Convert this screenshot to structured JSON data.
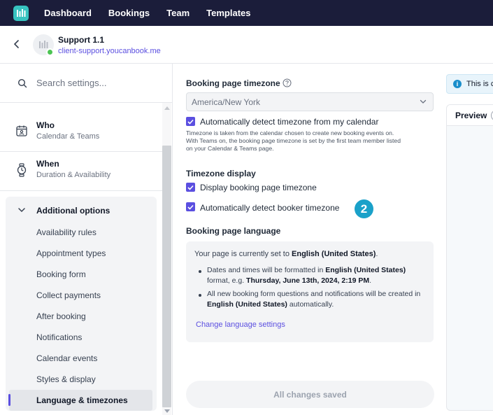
{
  "topnav": {
    "links": [
      "Dashboard",
      "Bookings",
      "Team",
      "Templates"
    ]
  },
  "header": {
    "title": "Support 1.1",
    "subtitle": "client-support.youcanbook.me"
  },
  "sidebar": {
    "search_placeholder": "Search settings...",
    "items": [
      {
        "title": "Who",
        "subtitle": "Calendar & Teams",
        "icon": "calendar-person-icon"
      },
      {
        "title": "When",
        "subtitle": "Duration & Availability",
        "icon": "watch-icon"
      }
    ],
    "additional": {
      "label": "Additional options",
      "items": [
        "Availability rules",
        "Appointment types",
        "Booking form",
        "Collect payments",
        "After booking",
        "Notifications",
        "Calendar events",
        "Styles & display"
      ],
      "active": "Language & timezones"
    }
  },
  "main": {
    "tz_label": "Booking page timezone",
    "tz_value": "America/New York",
    "auto_detect_tz": "Automatically detect timezone from my calendar",
    "hint_lines": [
      "Timezone is taken from the calendar chosen to create new booking events on.",
      "With Teams on, the booking page timezone is set by the first team member listed",
      "on your Calendar & Teams page."
    ],
    "display_label": "Timezone display",
    "display_tz": "Display booking page timezone",
    "auto_booker_tz": "Automatically detect booker timezone",
    "step_badge": "2",
    "lang_label": "Booking page language",
    "lang": {
      "line1_pre": "Your page is currently set to ",
      "line1_bold": "English (United States)",
      "line1_post": ".",
      "b1_pre": "Dates and times will be formatted in ",
      "b1_bold": "English (United States)",
      "b1_mid": " format, e.g. ",
      "b1_bold2": "Thursday, June 13th, 2024, 2:19 PM",
      "b1_post": ".",
      "b2_pre": "All new booking form questions and notifications will be created in ",
      "b2_bold": "English (United States)",
      "b2_post": " automatically.",
      "link": "Change language settings"
    },
    "save": "All changes saved"
  },
  "preview": {
    "info_text": "This is c",
    "title": "Preview"
  }
}
